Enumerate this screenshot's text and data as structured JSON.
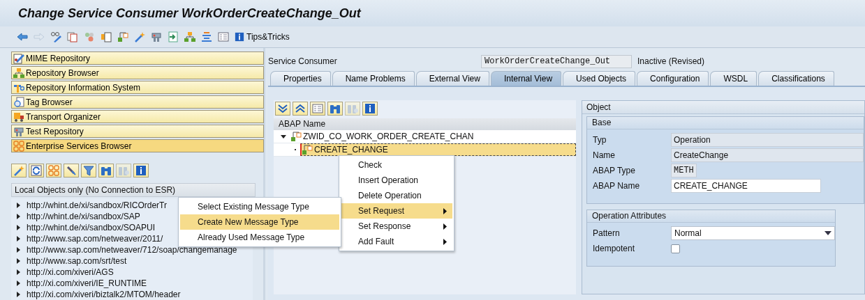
{
  "window": {
    "title": "Change Service Consumer WorkOrderCreateChange_Out"
  },
  "toolbar": {
    "buttons": [
      {
        "kind": "back",
        "disabled": false
      },
      {
        "kind": "forward",
        "disabled": true
      },
      {
        "kind": "glasses",
        "disabled": false
      },
      {
        "kind": "copy",
        "disabled": false
      },
      {
        "kind": "dots",
        "disabled": false
      },
      {
        "kind": "newdoc",
        "disabled": false
      },
      {
        "kind": "hierarchy",
        "disabled": false
      },
      {
        "kind": "wand",
        "disabled": false
      },
      {
        "kind": "machine",
        "disabled": false
      },
      {
        "kind": "import",
        "disabled": false
      },
      {
        "kind": "orgchart",
        "disabled": false
      },
      {
        "kind": "align",
        "disabled": false
      },
      {
        "kind": "list",
        "disabled": false
      }
    ],
    "tips_label": "Tips&Tricks"
  },
  "navigation": [
    {
      "label": "MIME Repository",
      "kind": "pencildoc",
      "selected": false
    },
    {
      "label": "Repository Browser",
      "kind": "orgchart",
      "selected": false
    },
    {
      "label": "Repository Information System",
      "kind": "tool",
      "selected": false
    },
    {
      "label": "Tag Browser",
      "kind": "tag",
      "selected": false
    },
    {
      "label": "Transport Organizer",
      "kind": "truck",
      "selected": false
    },
    {
      "label": "Test Repository",
      "kind": "machine",
      "selected": false
    },
    {
      "label": "Enterprise Services Browser",
      "kind": "squares",
      "selected": true
    }
  ],
  "browser_toolbar": [
    {
      "kind": "wand",
      "disabled": false
    },
    {
      "kind": "refresh",
      "disabled": false
    },
    {
      "kind": "squares",
      "disabled": false
    },
    {
      "kind": "plug",
      "disabled": false
    },
    {
      "kind": "funnel",
      "disabled": false
    },
    {
      "kind": "binoculars",
      "disabled": false
    },
    {
      "kind": "binocularsplus",
      "disabled": true
    },
    {
      "kind": "info",
      "disabled": false
    }
  ],
  "browser": {
    "header": "Local Objects only (No Connection to ESR)",
    "items": [
      {
        "label": "http://whint.de/xi/sandbox/RICOrderTr",
        "expanded": false
      },
      {
        "label": "http://whint.de/xi/sandbox/SAP",
        "expanded": false
      },
      {
        "label": "http://whint.de/xi/sandbox/SOAPUI",
        "expanded": false
      },
      {
        "label": "http://www.sap.com/netweaver/2011/",
        "expanded": false
      },
      {
        "label": "http://www.sap.com/netweaver/712/soap/changemanage",
        "expanded": false
      },
      {
        "label": "http://www.sap.com/srt/test",
        "expanded": false
      },
      {
        "label": "http://xi.com/xiveri/AGS",
        "expanded": false
      },
      {
        "label": "http://xi.com/xiveri/IE_RUNTIME",
        "expanded": false
      },
      {
        "label": "http://xi.com/xiveri/biztalk2/MTOM/header",
        "expanded": false
      }
    ]
  },
  "object_header": {
    "label": "Service Consumer",
    "name": "WorkOrderCreateChange_Out",
    "status": "Inactive (Revised)"
  },
  "tabs": [
    {
      "label": "Properties",
      "selected": false
    },
    {
      "label": "Name Problems",
      "selected": false
    },
    {
      "label": "External View",
      "selected": false
    },
    {
      "label": "Internal View",
      "selected": true
    },
    {
      "label": "Used Objects",
      "selected": false
    },
    {
      "label": "Configuration",
      "selected": false
    },
    {
      "label": "WSDL",
      "selected": false
    },
    {
      "label": "Classifications",
      "selected": false
    }
  ],
  "tree_toolbar": [
    {
      "kind": "expand",
      "disabled": false
    },
    {
      "kind": "collapse",
      "disabled": false
    },
    {
      "kind": "list",
      "disabled": false
    },
    {
      "kind": "binoculars",
      "disabled": false
    },
    {
      "kind": "binocularsplus",
      "disabled": true
    },
    {
      "kind": "info",
      "disabled": false
    }
  ],
  "tree": {
    "column": "ABAP Name",
    "nodes": [
      {
        "label": "ZWID_CO_WORK_ORDER_CREATE_CHAN",
        "expanded": true,
        "selected": false,
        "children": [
          {
            "label": "CREATE_CHANGE",
            "selected": true
          }
        ]
      }
    ]
  },
  "context_menu": [
    {
      "label": "Check",
      "submenu": false,
      "selected": false
    },
    {
      "label": "Insert Operation",
      "submenu": false,
      "selected": false
    },
    {
      "label": "Delete Operation",
      "submenu": false,
      "selected": false
    },
    {
      "label": "Set Request",
      "submenu": true,
      "selected": true
    },
    {
      "label": "Set Response",
      "submenu": true,
      "selected": false
    },
    {
      "label": "Add Fault",
      "submenu": true,
      "selected": false
    }
  ],
  "submenu": [
    {
      "label": "Select Existing Message Type",
      "selected": false
    },
    {
      "label": "Create New Message Type",
      "selected": true
    },
    {
      "label": "Already Used Message Type",
      "selected": false
    }
  ],
  "object_panel": {
    "title": "Object",
    "base": {
      "title": "Base",
      "fields": [
        {
          "label": "Typ",
          "value": "Operation",
          "kind": "display"
        },
        {
          "label": "Name",
          "value": "CreateChange",
          "kind": "display"
        },
        {
          "label": "ABAP Type",
          "value": "METH",
          "kind": "code"
        },
        {
          "label": "ABAP Name",
          "value": "CREATE_CHANGE",
          "kind": "input"
        }
      ]
    },
    "attributes": {
      "title": "Operation Attributes",
      "pattern_label": "Pattern",
      "pattern": "Normal",
      "idempotent_label": "Idempotent",
      "idempotent": false
    }
  }
}
